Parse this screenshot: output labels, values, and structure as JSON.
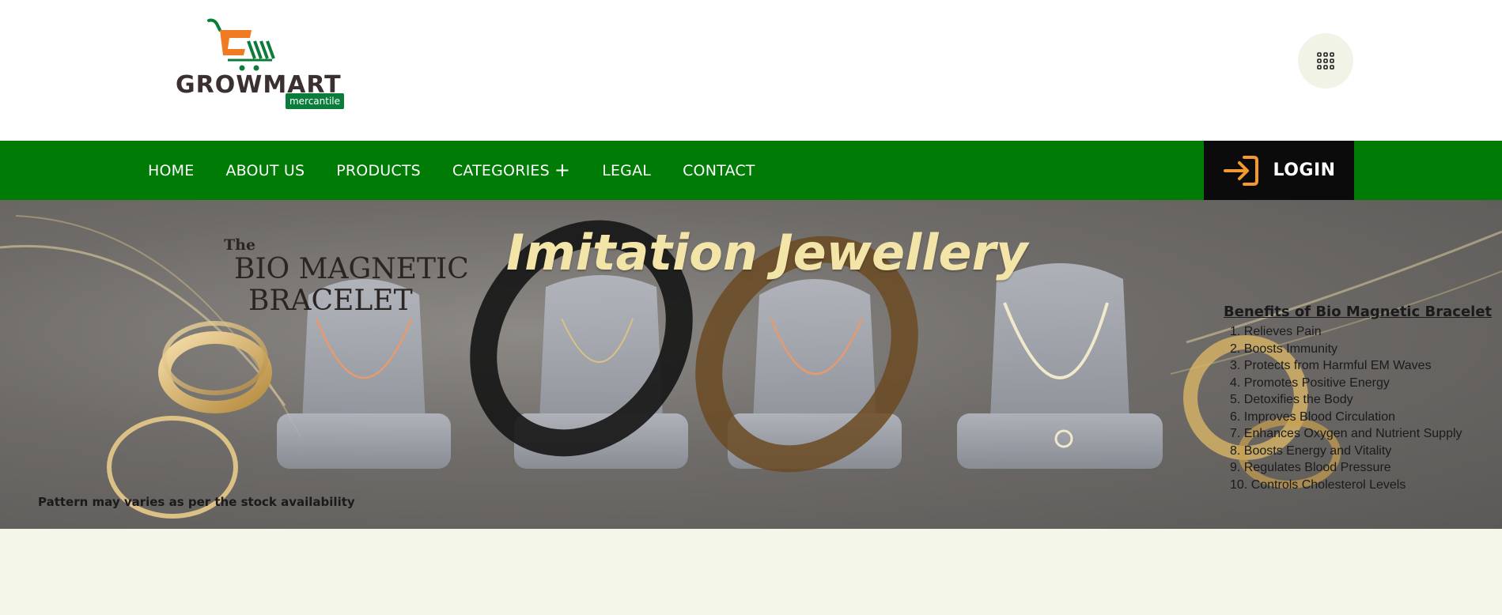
{
  "brand": {
    "name": "GROWMART",
    "tagline": "mercantile"
  },
  "nav": {
    "items": [
      {
        "label": "HOME"
      },
      {
        "label": "ABOUT US"
      },
      {
        "label": "PRODUCTS"
      },
      {
        "label": "CATEGORIES"
      },
      {
        "label": "LEGAL"
      },
      {
        "label": "CONTACT"
      }
    ],
    "login_label": "LOGIN"
  },
  "hero": {
    "title": "Imitation Jewellery",
    "bio_the": "The",
    "bio_line1": "BIO MAGNETIC",
    "bio_line2": "BRACELET",
    "benefits_title": "Benefits of Bio Magnetic Bracelet",
    "benefits": [
      "1. Relieves Pain",
      "2. Boosts Immunity",
      "3. Protects from Harmful EM Waves",
      "4. Promotes Positive Energy",
      "5. Detoxifies the Body",
      "6. Improves Blood Circulation",
      "7. Enhances Oxygen and Nutrient Supply",
      "8. Boosts Energy and Vitality",
      "9. Regulates Blood Pressure",
      "10. Controls Cholesterol Levels"
    ],
    "note": "Pattern may varies as per the stock availability"
  },
  "colors": {
    "nav_green": "#007b05",
    "login_bg": "#0b0b0b",
    "login_icon": "#f29a2e",
    "page_bg": "#f4f6ea",
    "logo_green": "#0a7d3a",
    "logo_orange": "#f07b22"
  },
  "icons": {
    "menu": "grid-icon",
    "login": "sign-in-icon",
    "categories": "plus-icon"
  }
}
